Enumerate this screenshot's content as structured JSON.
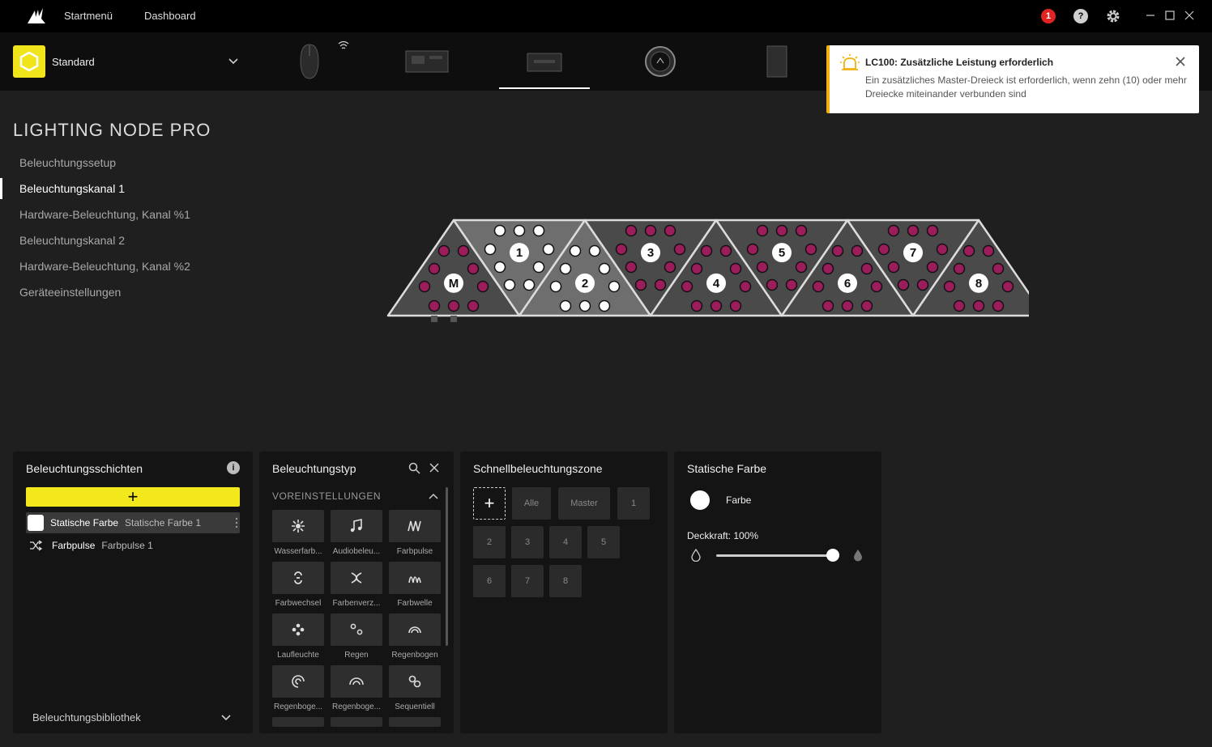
{
  "topbar": {
    "nav_home": "Startmenü",
    "nav_dashboard": "Dashboard",
    "notification_count": "1",
    "help_label": "?"
  },
  "profile": {
    "name": "Standard"
  },
  "toast": {
    "title": "LC100: Zusätzliche Leistung erforderlich",
    "body": "Ein zusätzliches Master-Dreieck ist erforderlich, wenn zehn (10) oder mehr Dreiecke miteinander verbunden sind"
  },
  "device": {
    "title": "LIGHTING NODE PRO"
  },
  "sidebar": {
    "items": [
      {
        "label": "Beleuchtungssetup"
      },
      {
        "label": "Beleuchtungskanal 1"
      },
      {
        "label": "Hardware-Beleuchtung, Kanal %1"
      },
      {
        "label": "Beleuchtungskanal 2"
      },
      {
        "label": "Hardware-Beleuchtung, Kanal %2"
      },
      {
        "label": "Geräteeinstellungen"
      }
    ]
  },
  "triangles": {
    "labels": [
      "M",
      "1",
      "2",
      "3",
      "4",
      "5",
      "6",
      "7",
      "8"
    ]
  },
  "layers": {
    "title": "Beleuchtungsschichten",
    "add_symbol": "+",
    "items": [
      {
        "name": "Statische Farbe",
        "sub": "Statische Farbe 1"
      },
      {
        "name": "Farbpulse",
        "sub": "Farbpulse 1"
      }
    ],
    "library": "Beleuchtungsbibliothek"
  },
  "lighting_type": {
    "title": "Beleuchtungstyp",
    "section": "VOREINSTELLUNGEN",
    "tiles": [
      {
        "label": "Wasserfarb...",
        "icon": "waterfall-icon"
      },
      {
        "label": "Audiobeleu...",
        "icon": "music-note-icon"
      },
      {
        "label": "Farbpulse",
        "icon": "pulse-icon"
      },
      {
        "label": "Farbwechsel",
        "icon": "color-shift-icon"
      },
      {
        "label": "Farbenverz...",
        "icon": "warp-icon"
      },
      {
        "label": "Farbwelle",
        "icon": "wave-icon"
      },
      {
        "label": "Laufleuchte",
        "icon": "marquee-icon"
      },
      {
        "label": "Regen",
        "icon": "rain-icon"
      },
      {
        "label": "Regenbogen",
        "icon": "rainbow-icon"
      },
      {
        "label": "Regenboge...",
        "icon": "rainbow-spiral-icon"
      },
      {
        "label": "Regenboge...",
        "icon": "rainbow-wave-icon"
      },
      {
        "label": "Sequentiell",
        "icon": "sequential-icon"
      }
    ]
  },
  "quick_zone": {
    "title": "Schnellbeleuchtungszone",
    "add_symbol": "+",
    "zones": [
      "Alle",
      "Master",
      "1",
      "2",
      "3",
      "4",
      "5",
      "6",
      "7",
      "8"
    ]
  },
  "static_color": {
    "title": "Statische Farbe",
    "color_label": "Farbe",
    "opacity_label": "Deckkraft: 100%",
    "opacity_value": 100,
    "color": "#ffffff"
  },
  "colors": {
    "accent_yellow": "#f2e81c",
    "led_magenta": "#9c1d5b",
    "toast_warning": "#f2b10f"
  }
}
